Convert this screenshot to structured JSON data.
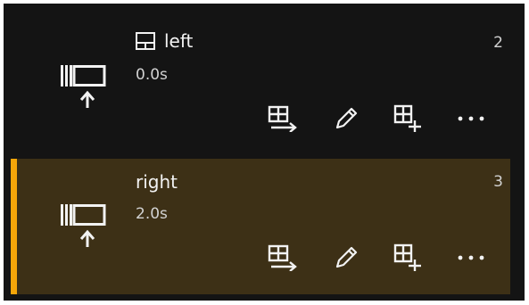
{
  "items": [
    {
      "title": "left",
      "duration": "0.0s",
      "count": "2",
      "selected": false,
      "title_icon": "layout-icon",
      "thumbnail_icon": "slide-in-up-icon"
    },
    {
      "title": "right",
      "duration": "2.0s",
      "count": "3",
      "selected": true,
      "title_icon": null,
      "thumbnail_icon": "slide-in-up-icon"
    }
  ],
  "actions": [
    {
      "name": "move-to-icon"
    },
    {
      "name": "edit-pencil-icon"
    },
    {
      "name": "add-copy-icon"
    },
    {
      "name": "more-options-icon"
    }
  ],
  "colors": {
    "background": "#141414",
    "selected_row": "#3d3016",
    "accent": "#f6a609",
    "text": "#f2f2f2",
    "secondary_text": "#d2d2d2"
  }
}
